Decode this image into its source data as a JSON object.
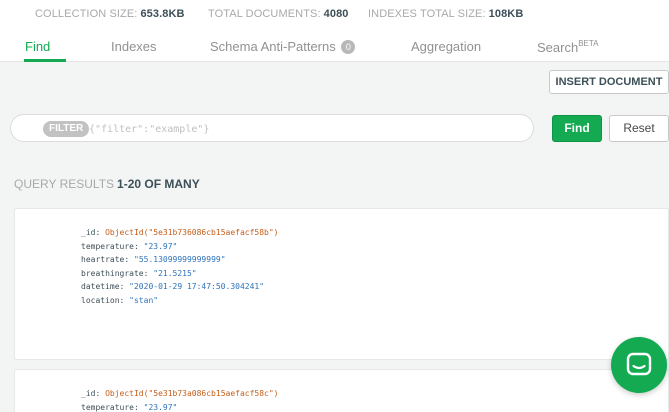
{
  "stats": {
    "collection_size_label": "COLLECTION SIZE:",
    "collection_size_value": "653.8KB",
    "total_documents_label": "TOTAL DOCUMENTS:",
    "total_documents_value": "4080",
    "indexes_size_label": "INDEXES TOTAL SIZE:",
    "indexes_size_value": "108KB"
  },
  "tabs": {
    "find": "Find",
    "indexes": "Indexes",
    "schema": "Schema Anti-Patterns",
    "schema_badge": "0",
    "aggregation": "Aggregation",
    "search": "Search",
    "search_sup": "BETA"
  },
  "toolbar": {
    "insert_label": "INSERT DOCUMENT",
    "filter_tag": "FILTER",
    "filter_placeholder": "{\"filter\":\"example\"}",
    "find_label": "Find",
    "reset_label": "Reset"
  },
  "results": {
    "label": "QUERY RESULTS",
    "range": "1-20 OF MANY"
  },
  "documents": [
    {
      "fields": [
        {
          "key": "_id",
          "kind": "oid",
          "value": "ObjectId(\"5e31b736086cb15aefacf58b\")"
        },
        {
          "key": "temperature",
          "kind": "str",
          "value": "\"23.97\""
        },
        {
          "key": "heartrate",
          "kind": "str",
          "value": "\"55.13099999999999\""
        },
        {
          "key": "breathingrate",
          "kind": "str",
          "value": "\"21.5215\""
        },
        {
          "key": "datetime",
          "kind": "str",
          "value": "\"2020-01-29 17:47:50.304241\""
        },
        {
          "key": "location",
          "kind": "str",
          "value": "\"stan\""
        }
      ]
    },
    {
      "fields": [
        {
          "key": "_id",
          "kind": "oid",
          "value": "ObjectId(\"5e31b73a086cb15aefacf58c\")"
        },
        {
          "key": "temperature",
          "kind": "str",
          "value": "\"23.97\""
        }
      ]
    }
  ],
  "chat": {
    "icon": "chat-bubble-icon",
    "color": "#13aa52"
  }
}
